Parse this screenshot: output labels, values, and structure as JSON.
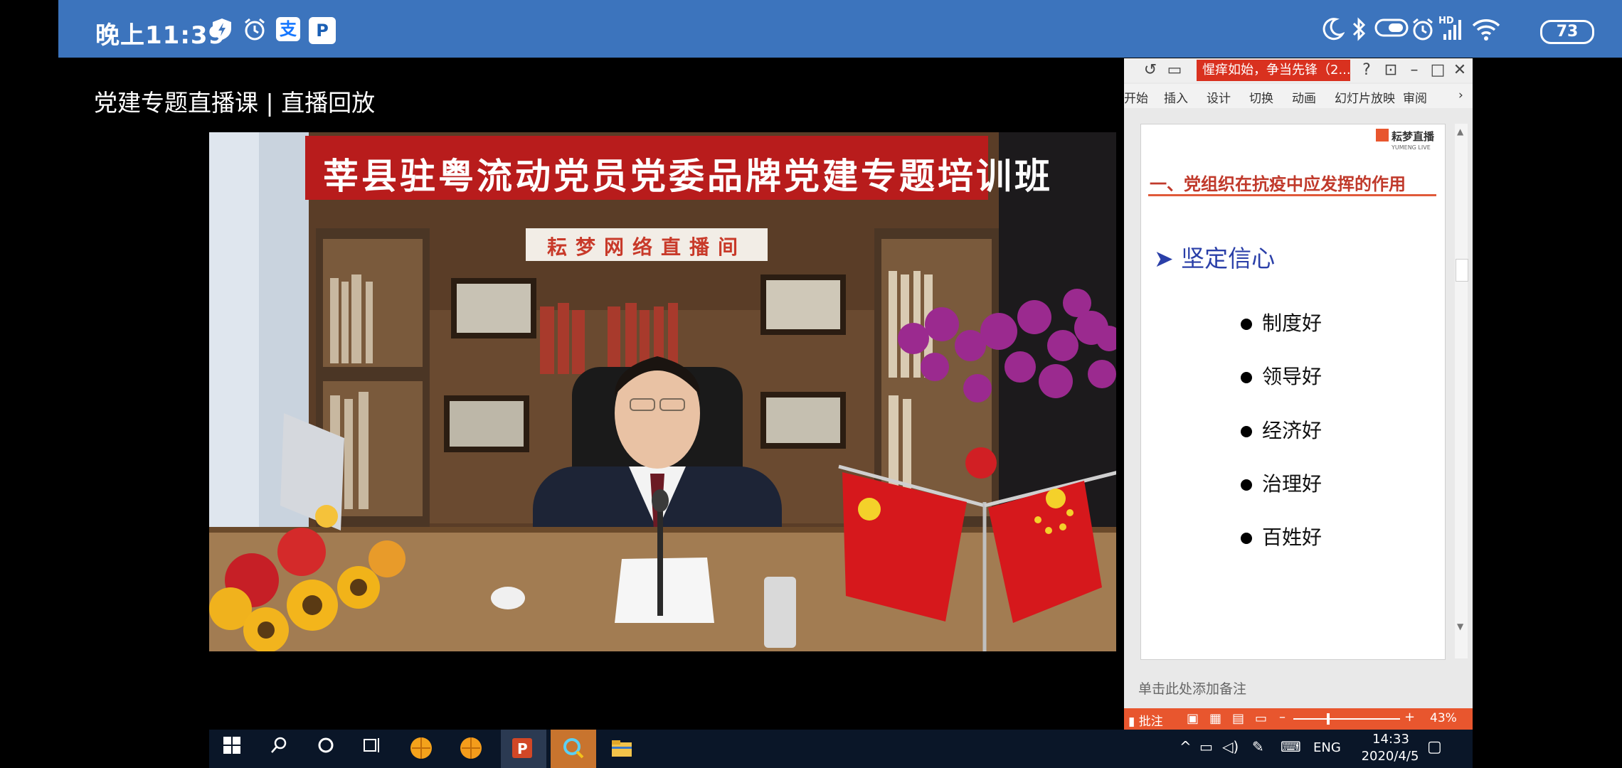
{
  "status_bar": {
    "time": "晚上11:39",
    "battery": "73",
    "icons_left": [
      "shield-bolt-icon",
      "alarm-icon",
      "alipay-icon",
      "app-p-icon"
    ],
    "icons_right": [
      "moon-icon",
      "bluetooth-icon",
      "toggle-icon",
      "alarm-icon",
      "signal-icon",
      "wifi-icon"
    ],
    "hd_label": "HD",
    "color": "#3c74bd"
  },
  "page": {
    "title": "党建专题直播课 | 直播回放"
  },
  "video": {
    "banner": "莘县驻粤流动党员党委品牌党建专题培训班",
    "sign": "耘梦网络直播间"
  },
  "ppt": {
    "doc_title": "惺痒如始，争当先锋（2...",
    "titlebar_buttons": [
      "?",
      "⊡",
      "–",
      "□",
      "✕"
    ],
    "ribbon_tabs": [
      "开始",
      "插入",
      "设计",
      "切换",
      "动画",
      "幻灯片放映",
      "审阅"
    ],
    "slide": {
      "logo_text": "耘梦直播",
      "logo_sub": "YUMENG LIVE",
      "heading": "一、党组织在抗疫中应发挥的作用",
      "subheading": "➤ 坚定信心",
      "bullets": [
        "制度好",
        "领导好",
        "经济好",
        "治理好",
        "百姓好"
      ]
    },
    "notes_placeholder": "单击此处添加备注",
    "status": {
      "comments": "批注",
      "zoom": "43%"
    },
    "accent": "#e8562e"
  },
  "taskbar": {
    "language": "ENG",
    "time": "14:33",
    "date": "2020/4/5"
  }
}
